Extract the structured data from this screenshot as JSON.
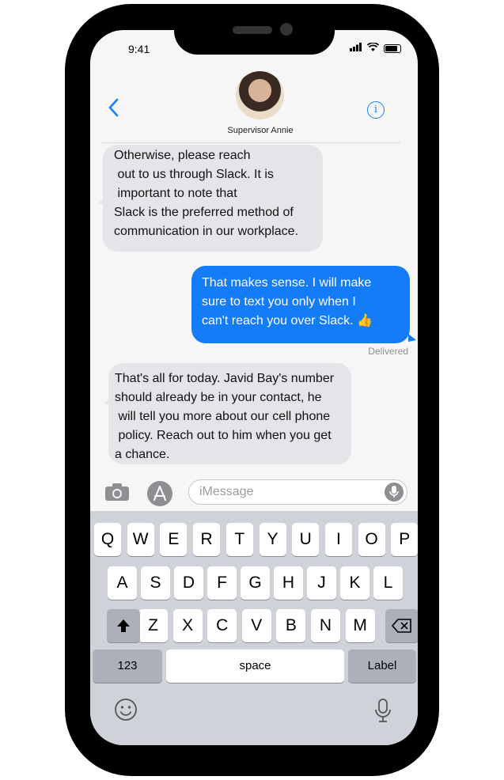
{
  "status_bar": {
    "time": "9:41"
  },
  "header": {
    "contact_name": "Supervisor  Annie",
    "back_icon": "chevron-left-icon",
    "info_icon": "info-icon"
  },
  "messages": [
    {
      "side": "received",
      "text": "Otherwise, please reach\n out to us through Slack. It is\n important to note that\nSlack is the preferred method of\ncommunication in our workplace."
    },
    {
      "side": "sent",
      "text": "That makes sense. I will make\nsure to text you only when I\ncan't reach you over Slack. 👍"
    },
    {
      "side": "received",
      "text": "That's all for today. Javid Bay's number\nshould already be in your contact, he\n will tell you more about our cell phone\n policy. Reach out to him when you get\na chance."
    }
  ],
  "delivered_label": "Delivered",
  "composer": {
    "placeholder": "iMessage",
    "camera_icon": "camera-icon",
    "apps_icon": "app-store-icon",
    "mic_icon": "microphone-icon"
  },
  "keyboard": {
    "row1": [
      "Q",
      "W",
      "E",
      "R",
      "T",
      "Y",
      "U",
      "I",
      "O",
      "P"
    ],
    "row2": [
      "A",
      "S",
      "D",
      "F",
      "G",
      "H",
      "J",
      "K",
      "L"
    ],
    "row3": [
      "Z",
      "X",
      "C",
      "V",
      "B",
      "N",
      "M"
    ],
    "numbers_key": "123",
    "space_key": "space",
    "return_key": "Label",
    "shift_icon": "shift-icon",
    "delete_icon": "backspace-icon",
    "emoji_icon": "emoji-icon",
    "dictation_icon": "microphone-icon"
  },
  "colors": {
    "accent": "#147cf6",
    "received_bubble": "#e4e4e9",
    "keyboard_bg": "#cfd2d8"
  }
}
